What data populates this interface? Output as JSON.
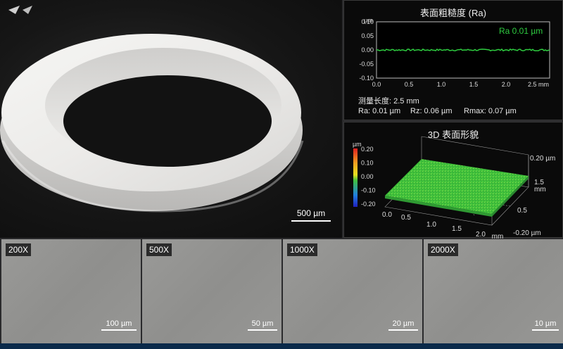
{
  "main_photo": {
    "scale_label": "500 µm"
  },
  "roughness": {
    "title": "表面粗糙度 (Ra)",
    "unit": "µm",
    "y_ticks": [
      "0.10",
      "0.05",
      "0.00",
      "-0.05",
      "-0.10"
    ],
    "x_ticks": [
      "0.0",
      "0.5",
      "1.0",
      "1.5",
      "2.0",
      "2.5 mm"
    ],
    "ra_badge": "Ra 0.01 µm",
    "line_color": "#2ecc40",
    "measure_length": "测量长度: 2.5 mm",
    "ra": "Ra: 0.01 µm",
    "rz": "Rz: 0.06 µm",
    "rmax": "Rmax: 0.07 µm"
  },
  "topography": {
    "title": "3D 表面形貌",
    "colorbar_unit": "µm",
    "colorbar_ticks": [
      "0.20",
      "0.10",
      "0.00",
      "-0.10",
      "-0.20"
    ],
    "z_top": "0.20 µm",
    "z_bottom": "-0.20 µm",
    "x_ticks": [
      "0.5",
      "1.0",
      "1.5",
      "2.0",
      "mm"
    ],
    "y_ticks": [
      "1.5",
      "mm",
      "0.5"
    ],
    "x_first": "0.0",
    "surface_color": "#3fbf3a"
  },
  "sem": [
    {
      "mag": "200X",
      "scale": "100 µm"
    },
    {
      "mag": "500X",
      "scale": "50 µm"
    },
    {
      "mag": "1000X",
      "scale": "20 µm"
    },
    {
      "mag": "2000X",
      "scale": "10 µm"
    }
  ]
}
